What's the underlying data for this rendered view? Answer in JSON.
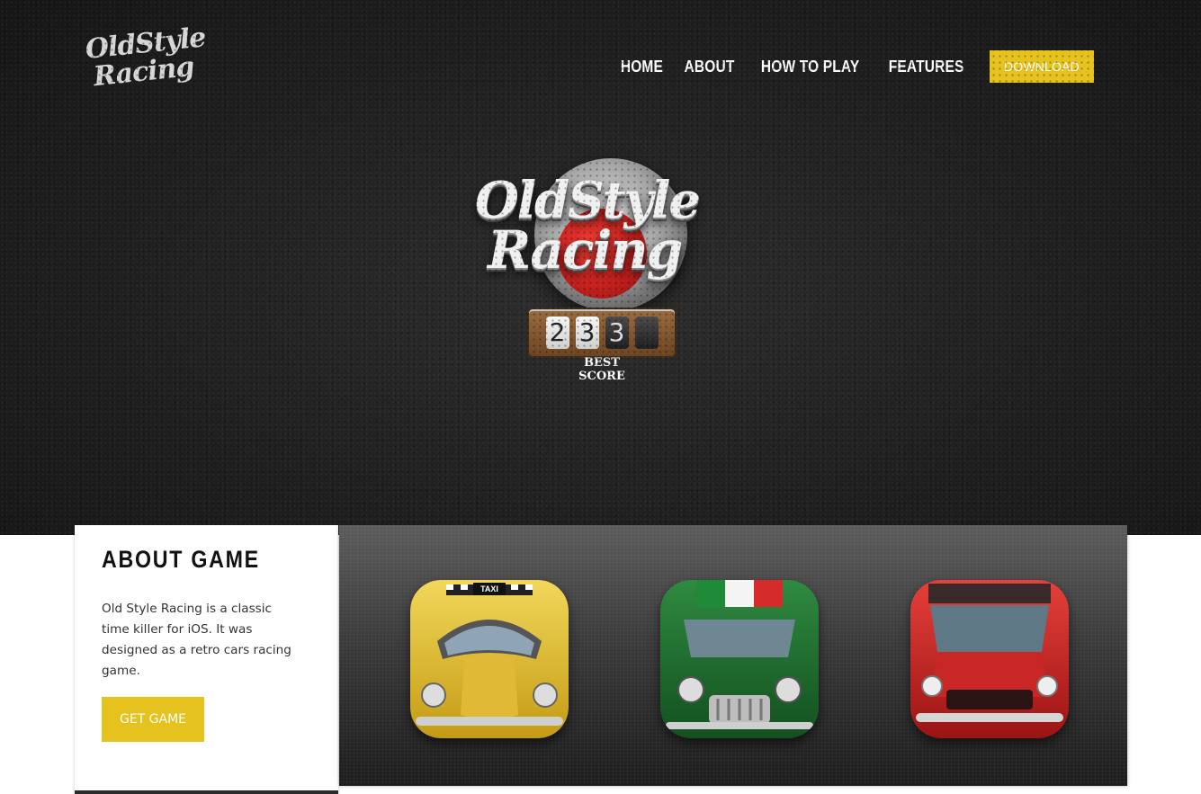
{
  "brand": {
    "line1": "OldStyle",
    "line2": "Racing"
  },
  "nav": {
    "items": [
      "HOME",
      "ABOUT",
      "HOW TO PLAY",
      "FEATURES"
    ],
    "download": "DOWNLOAD"
  },
  "hero": {
    "logo_line1": "OldStyle",
    "logo_line2": "Racing",
    "score_digits": [
      "2",
      "3",
      "3",
      ""
    ],
    "score_label": "BEST SCORE"
  },
  "about": {
    "title": "ABOUT GAME",
    "text": "Old Style Racing is a classic time killer for iOS. It was designed as a retro cars racing game.",
    "button": "GET GAME"
  },
  "cars": {
    "taxi_label": "TAXI"
  },
  "colors": {
    "accent": "#e6c21e",
    "hero_bg": "#222222",
    "taxi": "#e3c02b",
    "mini": "#1f6b2e",
    "mustang": "#c41f1f"
  }
}
